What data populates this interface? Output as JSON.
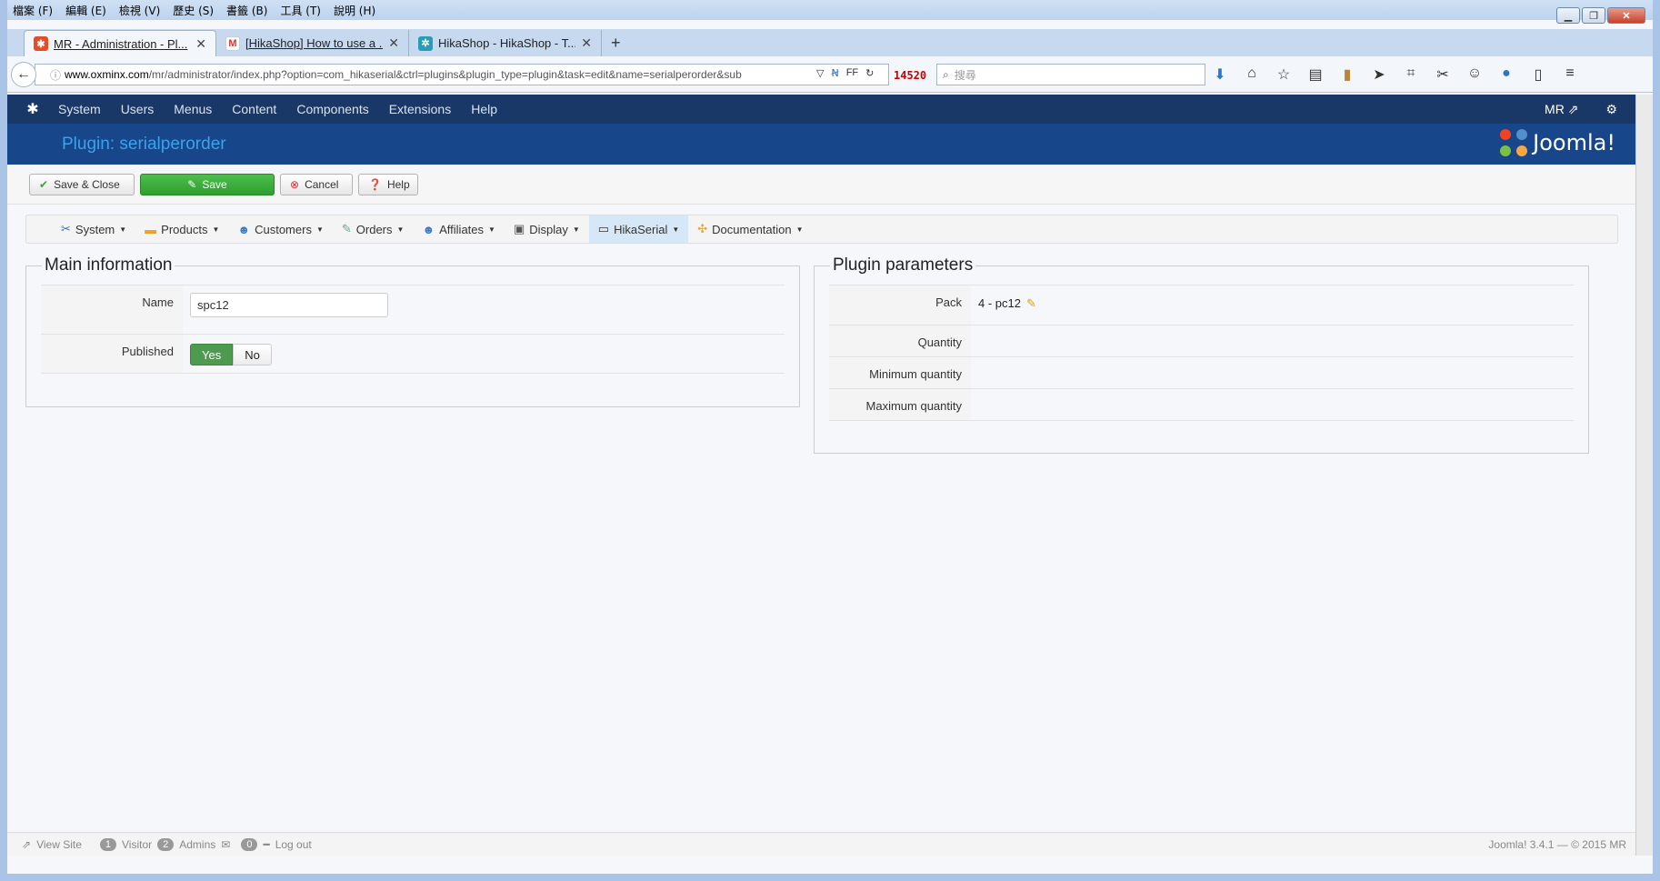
{
  "browser": {
    "menu": [
      "檔案 (F)",
      "編輯 (E)",
      "檢視 (V)",
      "歷史 (S)",
      "書籤 (B)",
      "工具 (T)",
      "說明 (H)"
    ],
    "tabs": [
      {
        "title": "MR - Administration - Pl..."
      },
      {
        "title": "[HikaShop] How to use a ..."
      },
      {
        "title": "HikaShop - HikaShop - T..."
      }
    ],
    "url_host": "www.oxminx.com",
    "url_rest": "/mr/administrator/index.php?option=com_hikaserial&ctrl=plugins&plugin_type=plugin&task=edit&name=serialperorder&sub",
    "counter": "14520",
    "search_placeholder": "搜尋",
    "ff_label": "FF"
  },
  "joomla": {
    "menu": [
      "System",
      "Users",
      "Menus",
      "Content",
      "Components",
      "Extensions",
      "Help"
    ],
    "user": "MR",
    "page_title": "Plugin: serialperorder",
    "logo_text": "Joomla!"
  },
  "toolbar": {
    "save_close": "Save & Close",
    "save": "Save",
    "cancel": "Cancel",
    "help": "Help"
  },
  "hikamenu": [
    "System",
    "Products",
    "Customers",
    "Orders",
    "Affiliates",
    "Display",
    "HikaSerial",
    "Documentation"
  ],
  "main_info": {
    "legend": "Main information",
    "name_label": "Name",
    "name_value": "spc12",
    "published_label": "Published",
    "yes": "Yes",
    "no": "No"
  },
  "params": {
    "legend": "Plugin parameters",
    "pack_label": "Pack",
    "pack_value": "4 - pc12",
    "quantity_label": "Quantity",
    "min_label": "Minimum quantity",
    "max_label": "Maximum quantity"
  },
  "status": {
    "view_site": "View Site",
    "visitor_count": "1",
    "visitor": "Visitor",
    "admins_count": "2",
    "admins": "Admins",
    "mail_count": "0",
    "logout": "Log out",
    "version": "Joomla! 3.4.1 — © 2015 MR"
  }
}
